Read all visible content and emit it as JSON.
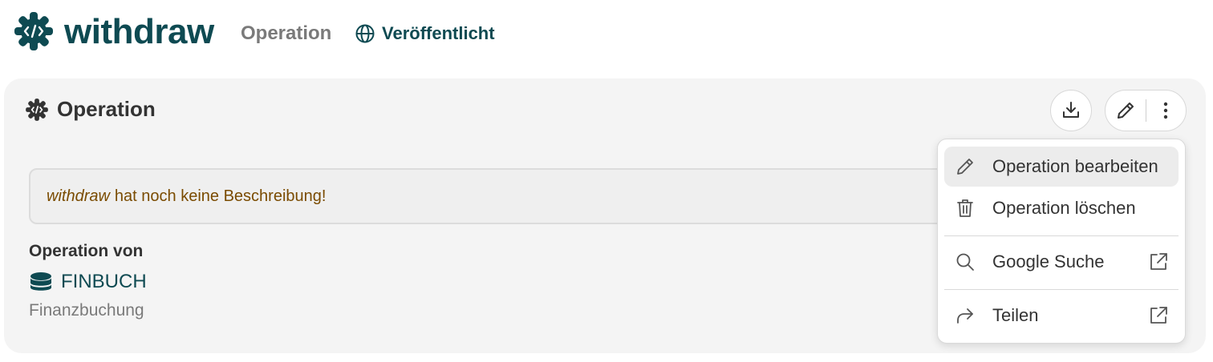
{
  "header": {
    "title": "withdraw",
    "type_label": "Operation",
    "status": "Veröffentlicht"
  },
  "card": {
    "title": "Operation",
    "description_name": "withdraw",
    "description_text": "hat noch keine Beschreibung!",
    "owner_label": "Operation von",
    "owner_link": "FINBUCH",
    "owner_description": "Finanzbuchung"
  },
  "menu": {
    "items": [
      {
        "label": "Operation bearbeiten",
        "icon": "pencil-icon"
      },
      {
        "label": "Operation löschen",
        "icon": "trash-icon"
      },
      {
        "label": "Google Suche",
        "icon": "search-icon"
      },
      {
        "label": "Teilen",
        "icon": "share-icon"
      }
    ]
  },
  "colors": {
    "brand": "#0e4a52",
    "warning_text": "#7a4b00",
    "card_bg": "#f4f4f4"
  }
}
